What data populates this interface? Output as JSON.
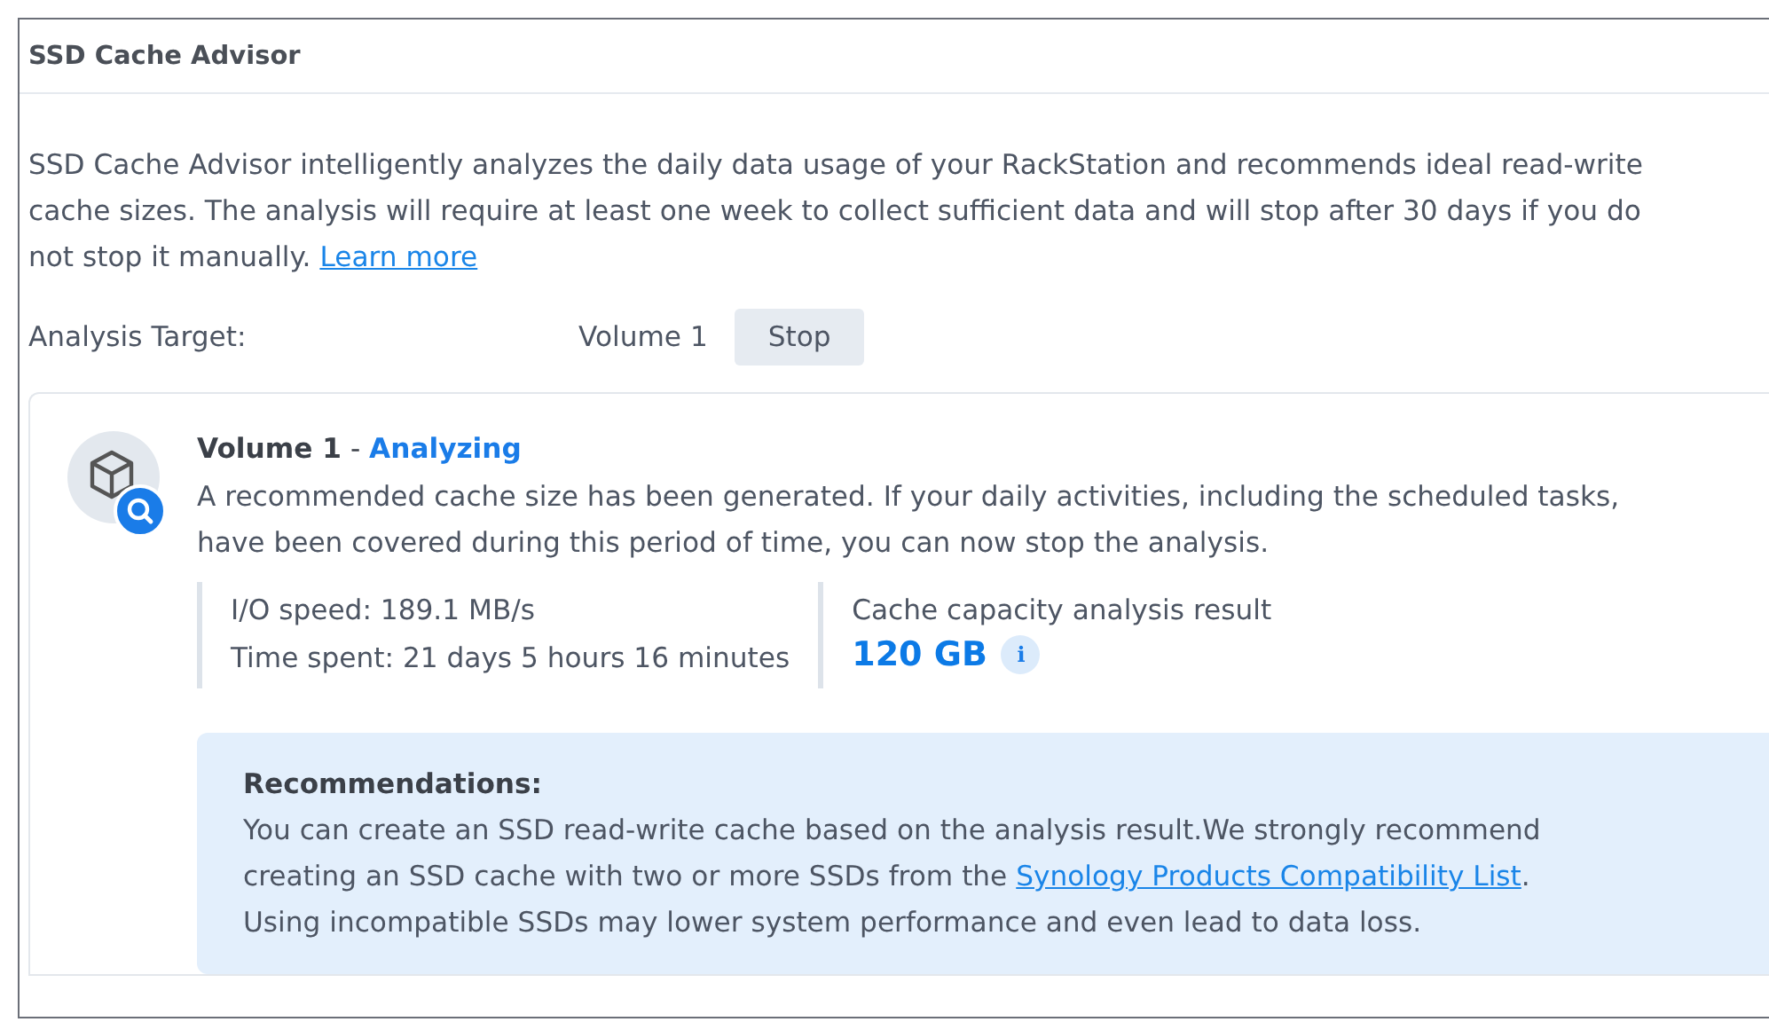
{
  "window": {
    "title": "SSD Cache Advisor"
  },
  "intro": {
    "lines": [
      {
        "text": "SSD Cache Advisor intelligently analyzes the daily data usage of your RackStation and recommends ideal read-write"
      },
      {
        "text": "cache sizes. The analysis will require at least one week to collect sufficient data and will stop after 30 days if you do"
      },
      {
        "text": "not stop it manually. ",
        "link": "Learn more"
      }
    ]
  },
  "analysis_target": {
    "label": "Analysis Target:",
    "value": "Volume 1",
    "button": "Stop"
  },
  "volume": {
    "name": "Volume 1",
    "separator": " - ",
    "status": "Analyzing",
    "description": [
      "A recommended cache size has been generated. If your daily activities, including the scheduled tasks,",
      "have been covered during this period of time, you can now stop the analysis."
    ],
    "stats": [
      "I/O speed: 189.1 MB/s",
      "Time spent: 21 days 5 hours 16 minutes"
    ],
    "result_label": "Cache capacity analysis result",
    "result_value": "120 GB",
    "info_icon": "i"
  },
  "recommendations": {
    "title": "Recommendations:",
    "lines": [
      {
        "text": "You can create an SSD read-write cache based on the analysis result.We strongly recommend"
      },
      {
        "text": "creating an SSD cache with two or more SSDs from the ",
        "link": "Synology Products Compatibility List",
        "after": "."
      },
      {
        "text": "Using incompatible SSDs may lower system performance and even lead to data loss."
      }
    ]
  }
}
